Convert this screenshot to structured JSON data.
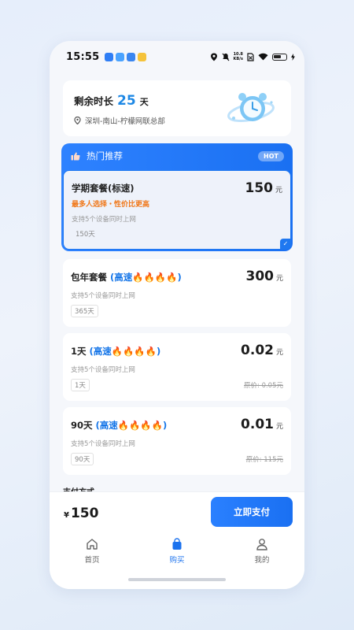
{
  "status_bar": {
    "time": "15:55",
    "net_speed_value": "10.8",
    "net_speed_unit": "KB/s",
    "app_icon_colors": [
      "#2f7ef5",
      "#4aa3ff",
      "#3a86f0",
      "#f5c33b"
    ]
  },
  "summary": {
    "remaining_label": "剩余时长",
    "remaining_days": "25",
    "remaining_unit": "天",
    "location": "深圳-南山-柠檬网联总部"
  },
  "hot_section": {
    "title": "热门推荐",
    "badge": "HOT"
  },
  "packages": [
    {
      "name": "学期套餐(标速)",
      "speed_label": "",
      "price": "150",
      "currency_unit": "元",
      "promo": "最多人选择・性价比更高",
      "description": "支持5个设备同时上网",
      "duration_tag": "150天",
      "original_price": "",
      "selected": true
    },
    {
      "name": "包年套餐",
      "speed_label": "(高速🔥🔥🔥🔥)",
      "price": "300",
      "currency_unit": "元",
      "promo": "",
      "description": "支持5个设备同时上网",
      "duration_tag": "365天",
      "original_price": "",
      "selected": false
    },
    {
      "name": "1天",
      "speed_label": "(高速🔥🔥🔥🔥)",
      "price": "0.02",
      "currency_unit": "元",
      "promo": "",
      "description": "支持5个设备同时上网",
      "duration_tag": "1天",
      "original_price": "原价: 0.05元",
      "selected": false
    },
    {
      "name": "90天",
      "speed_label": "(高速🔥🔥🔥🔥)",
      "price": "0.01",
      "currency_unit": "元",
      "promo": "",
      "description": "支持5个设备同时上网",
      "duration_tag": "90天",
      "original_price": "原价: 115元",
      "selected": false
    }
  ],
  "payment_method_label": "支付方式",
  "checkout": {
    "currency_symbol": "¥",
    "total": "150",
    "pay_button": "立即支付"
  },
  "tabs": [
    {
      "label": "首页",
      "icon": "home-icon",
      "active": false
    },
    {
      "label": "购买",
      "icon": "shopping-bag-icon",
      "active": true
    },
    {
      "label": "我的",
      "icon": "user-icon",
      "active": false
    }
  ],
  "colors": {
    "accent": "#1f78f0",
    "promo": "#f07617",
    "page_bg": "#f5f7fb"
  }
}
